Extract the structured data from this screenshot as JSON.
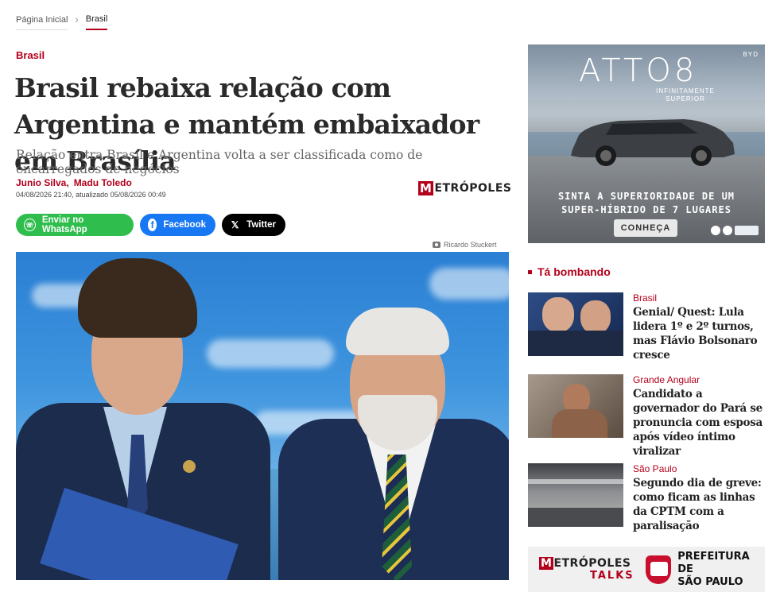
{
  "breadcrumb": {
    "home": "Página Inicial",
    "current": "Brasil"
  },
  "article": {
    "section": "Brasil",
    "headline": "Brasil rebaixa relação com Argentina e mantém embaixador em Brasília",
    "subtitle": "Relação entra Brasil e Argentina volta a ser classificada como de encarregados de negócios",
    "author1": "Junio Silva,",
    "author2": "Madu Toledo",
    "dates": "04/08/2026 21:40, atualizado 05/08/2026 00:49",
    "photo_credit": "Ricardo Stuckert"
  },
  "brand": {
    "logo_m": "M",
    "logo_rest": "ETRÓPOLES"
  },
  "share": {
    "whatsapp_label": "Enviar no WhatsApp",
    "facebook_label": "Facebook",
    "twitter_label": "Twitter",
    "facebook_glyph": "f",
    "twitter_glyph": "𝕏"
  },
  "ad": {
    "title": "ATTO8",
    "subtitle": "INFINITAMENTE SUPERIOR",
    "brand": "BYD",
    "line1": "SINTA A SUPERIORIDADE DE UM",
    "line2": "SUPER-HÍBRIDO DE 7 LUGARES",
    "cta": "CONHEÇA"
  },
  "trending": {
    "heading": "Tá bombando",
    "items": [
      {
        "category": "Brasil",
        "title": "Genial/ Quest: Lula lidera 1º e 2º turnos, mas Flávio Bolsonaro cresce"
      },
      {
        "category": "Grande Angular",
        "title": "Candidato a governador do Pará se pronuncia com esposa após vídeo íntimo viralizar"
      },
      {
        "category": "São Paulo",
        "title": "Segundo dia de greve: como ficam as linhas da CPTM com a paralisação"
      }
    ]
  },
  "bottom_banner": {
    "logo_m": "M",
    "logo_rest": "ETRÓPOLES",
    "talks": "TALKS",
    "pref_line1": "PREFEITURA DE",
    "pref_line2": "SÃO PAULO"
  },
  "colors": {
    "accent": "#b3001b",
    "whatsapp": "#2fbe4d",
    "facebook": "#1877f2",
    "twitter": "#000000"
  },
  "icons": [
    "chevron-right-icon",
    "whatsapp-icon",
    "facebook-icon",
    "x-icon",
    "camera-icon"
  ]
}
